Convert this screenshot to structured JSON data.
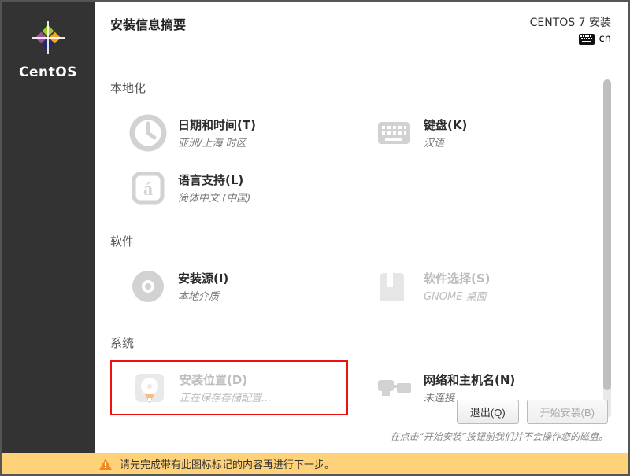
{
  "header": {
    "page_title": "安装信息摘要",
    "product_label": "CENTOS 7 安装",
    "keyboard_code": "cn"
  },
  "brand": "CentOS",
  "sections": {
    "localization": {
      "title": "本地化",
      "date_time": {
        "label": "日期和时间(T)",
        "status": "亚洲/上海 时区"
      },
      "keyboard": {
        "label": "键盘(K)",
        "status": "汉语"
      },
      "language": {
        "label": "语言支持(L)",
        "status": "简体中文 (中国)"
      }
    },
    "software": {
      "title": "软件",
      "source": {
        "label": "安装源(I)",
        "status": "本地介质"
      },
      "selection": {
        "label": "软件选择(S)",
        "status": "GNOME 桌面"
      }
    },
    "system": {
      "title": "系统",
      "destination": {
        "label": "安装位置(D)",
        "status": "正在保存存储配置..."
      },
      "network": {
        "label": "网络和主机名(N)",
        "status": "未连接"
      }
    }
  },
  "buttons": {
    "quit": "退出(Q)",
    "begin": "开始安装(B)"
  },
  "hint": "在点击“开始安装”按钮前我们并不会操作您的磁盘。",
  "warning": "请先完成带有此图标标记的内容再进行下一步。"
}
